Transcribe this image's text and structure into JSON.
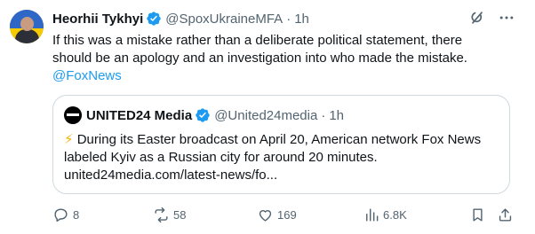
{
  "tweet": {
    "author_name": "Heorhii Tykhyi",
    "handle": "@SpoxUkraineMFA",
    "separator": "·",
    "time": "1h",
    "text_lines": [
      "If this was a mistake rather than a deliberate political statement, there",
      "should be an apology and an investigation into who made the mistake."
    ],
    "mention": "@FoxNews"
  },
  "quote": {
    "author_name": "UNITED24 Media",
    "handle": "@United24media",
    "separator": "·",
    "time": "1h",
    "bolt": "⚡",
    "text_line1": "During its Easter broadcast on April 20, American network Fox News",
    "text_line2": "labeled Kyiv as a Russian city for around 20 minutes.",
    "link": "united24media.com/latest-news/fo..."
  },
  "actions": {
    "replies": "8",
    "reposts": "58",
    "likes": "169",
    "views": "6.8K"
  },
  "colors": {
    "accent": "#1d9bf0",
    "verified": "#1d9bf0",
    "secondary_text": "#536471",
    "border": "#cfd9de"
  },
  "icons": [
    "grok-icon",
    "more-icon",
    "verified-icon",
    "reply-icon",
    "repost-icon",
    "like-icon",
    "views-icon",
    "bookmark-icon",
    "share-icon"
  ]
}
